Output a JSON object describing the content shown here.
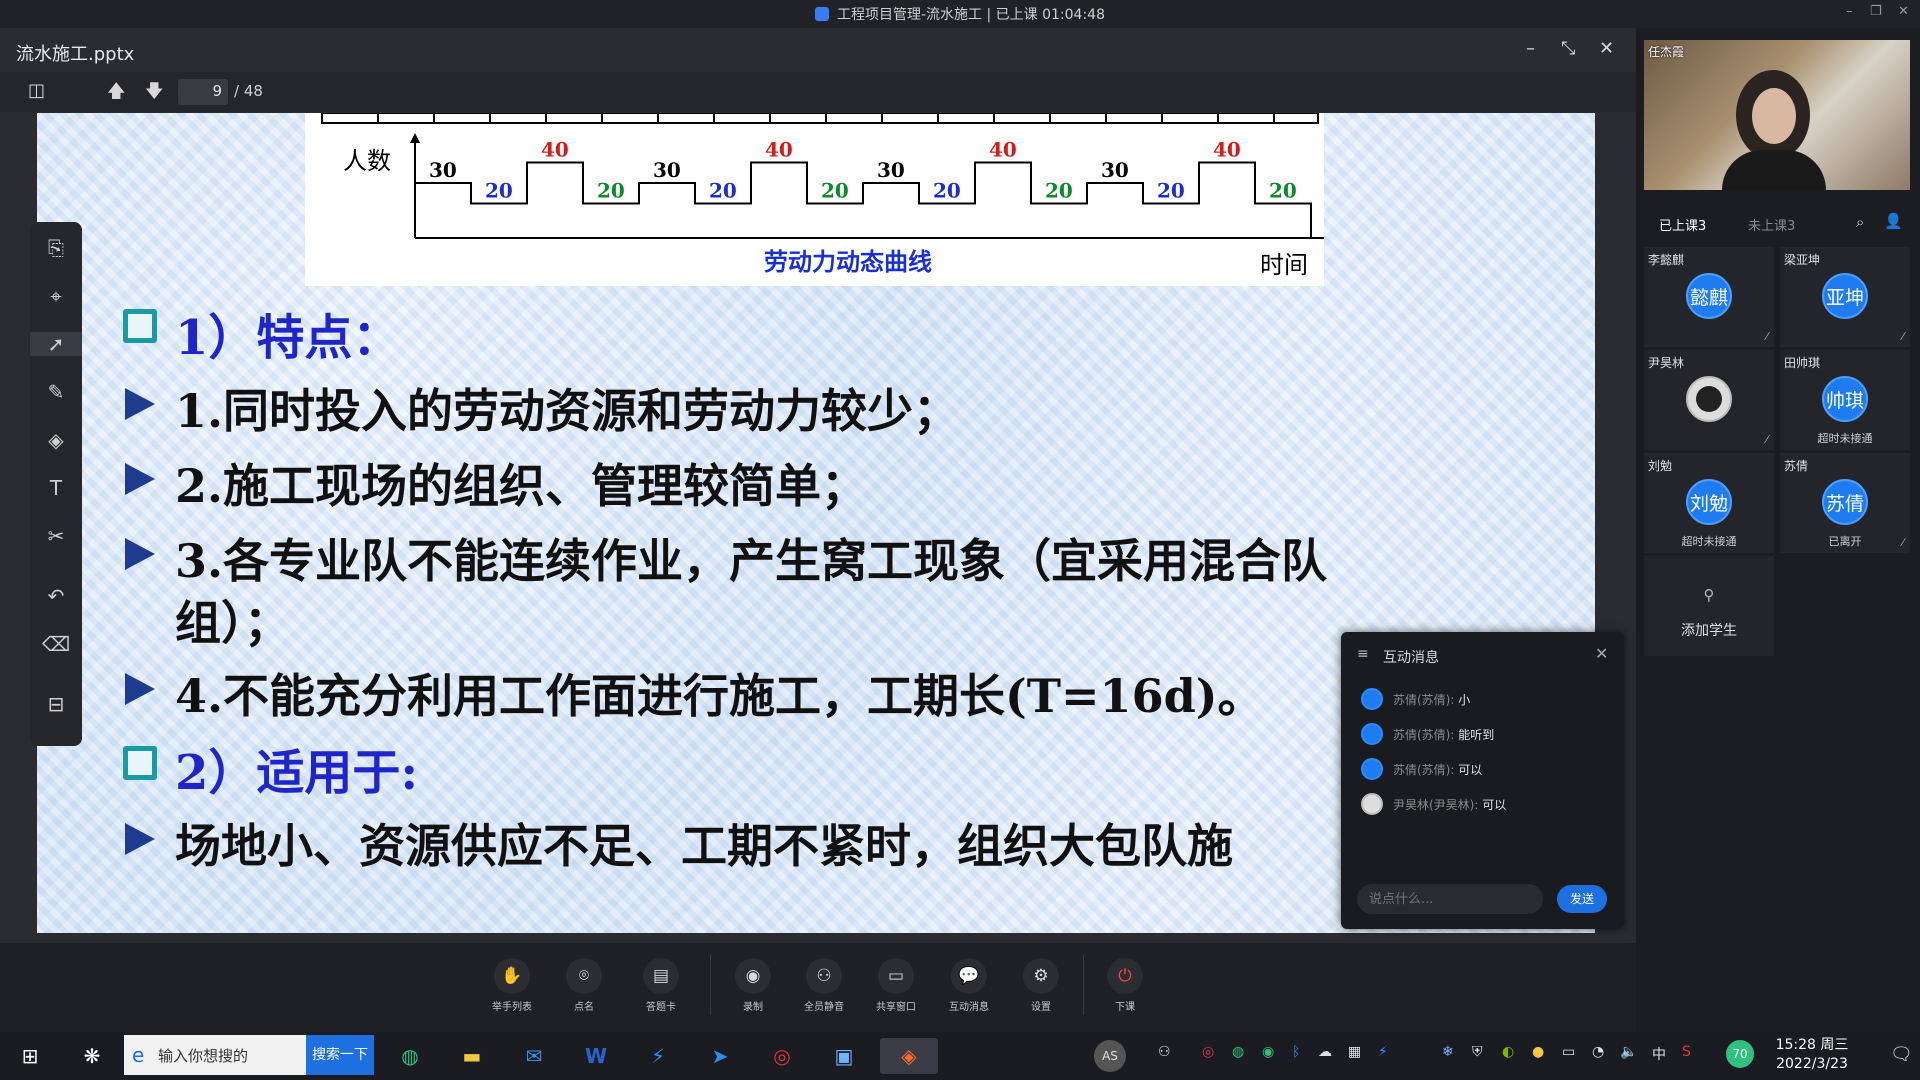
{
  "window": {
    "title": "工程项目管理-流水施工 | 已上课 01:04:48"
  },
  "document": {
    "title": "流水施工.pptx",
    "current_page": "9",
    "total_pages": "/ 48"
  },
  "slide": {
    "chart": {
      "ylabel": "人数",
      "xlabel": "时间",
      "caption": "劳动力动态曲线",
      "values": [
        "30",
        "20",
        "40",
        "20",
        "30",
        "20",
        "40",
        "20",
        "30",
        "20",
        "40",
        "20",
        "30",
        "20",
        "40",
        "20"
      ],
      "value_colors": [
        "#000000",
        "#1a2fd0",
        "#d41c1c",
        "#0d8a2a",
        "#000000",
        "#1a2fd0",
        "#d41c1c",
        "#0d8a2a",
        "#000000",
        "#1a2fd0",
        "#d41c1c",
        "#0d8a2a",
        "#000000",
        "#1a2fd0",
        "#d41c1c",
        "#0d8a2a"
      ]
    },
    "h1": "1）特点：",
    "b1": "1.同时投入的劳动资源和劳动力较少；",
    "b2": "2.施工现场的组织、管理较简单；",
    "b3a": "3.各专业队不能连续作业，产生窝工现象（宜采用混合队",
    "b3b": "组）；",
    "b4": "4.不能充分利用工作面进行施工，工期长(T=16d)。",
    "h2": "2）适用于:",
    "b5": "场地小、资源供应不足、工期不紧时，组织大包队施"
  },
  "right_panel": {
    "teacher_name": "任杰霞",
    "tab_attended": "已上课3",
    "tab_not_attended": "未上课3",
    "students": [
      {
        "name": "李懿麒",
        "avatar": "懿麒",
        "status": ""
      },
      {
        "name": "梁亚坤",
        "avatar": "亚坤",
        "status": ""
      },
      {
        "name": "尹昊林",
        "avatar": "",
        "status": ""
      },
      {
        "name": "田帅琪",
        "avatar": "帅琪",
        "status": "超时未接通"
      },
      {
        "name": "刘勉",
        "avatar": "刘勉",
        "status": "超时未接通"
      },
      {
        "name": "苏倩",
        "avatar": "苏倩",
        "status": "已离开"
      }
    ],
    "add_student": "添加学生"
  },
  "chat": {
    "title": "互动消息",
    "messages": [
      {
        "name": "苏倩(苏倩):",
        "text": "小"
      },
      {
        "name": "苏倩(苏倩):",
        "text": "能听到"
      },
      {
        "name": "苏倩(苏倩):",
        "text": "可以"
      },
      {
        "name": "尹昊林(尹昊林):",
        "text": "可以"
      }
    ],
    "placeholder": "说点什么...",
    "send": "发送"
  },
  "controls": {
    "raise_hands": "举手列表",
    "roll_call": "点名",
    "answer_card": "答题卡",
    "record": "录制",
    "mute_all": "全员静音",
    "share_window": "共享窗口",
    "messages": "互动消息",
    "settings": "设置",
    "end_class": "下课"
  },
  "taskbar": {
    "search_placeholder": "输入你想搜的",
    "search_button": "搜索一下",
    "avatar_initials": "AS",
    "weather_temp": "70",
    "ime": "中",
    "time": "15:28 周三",
    "date": "2022/3/23"
  }
}
